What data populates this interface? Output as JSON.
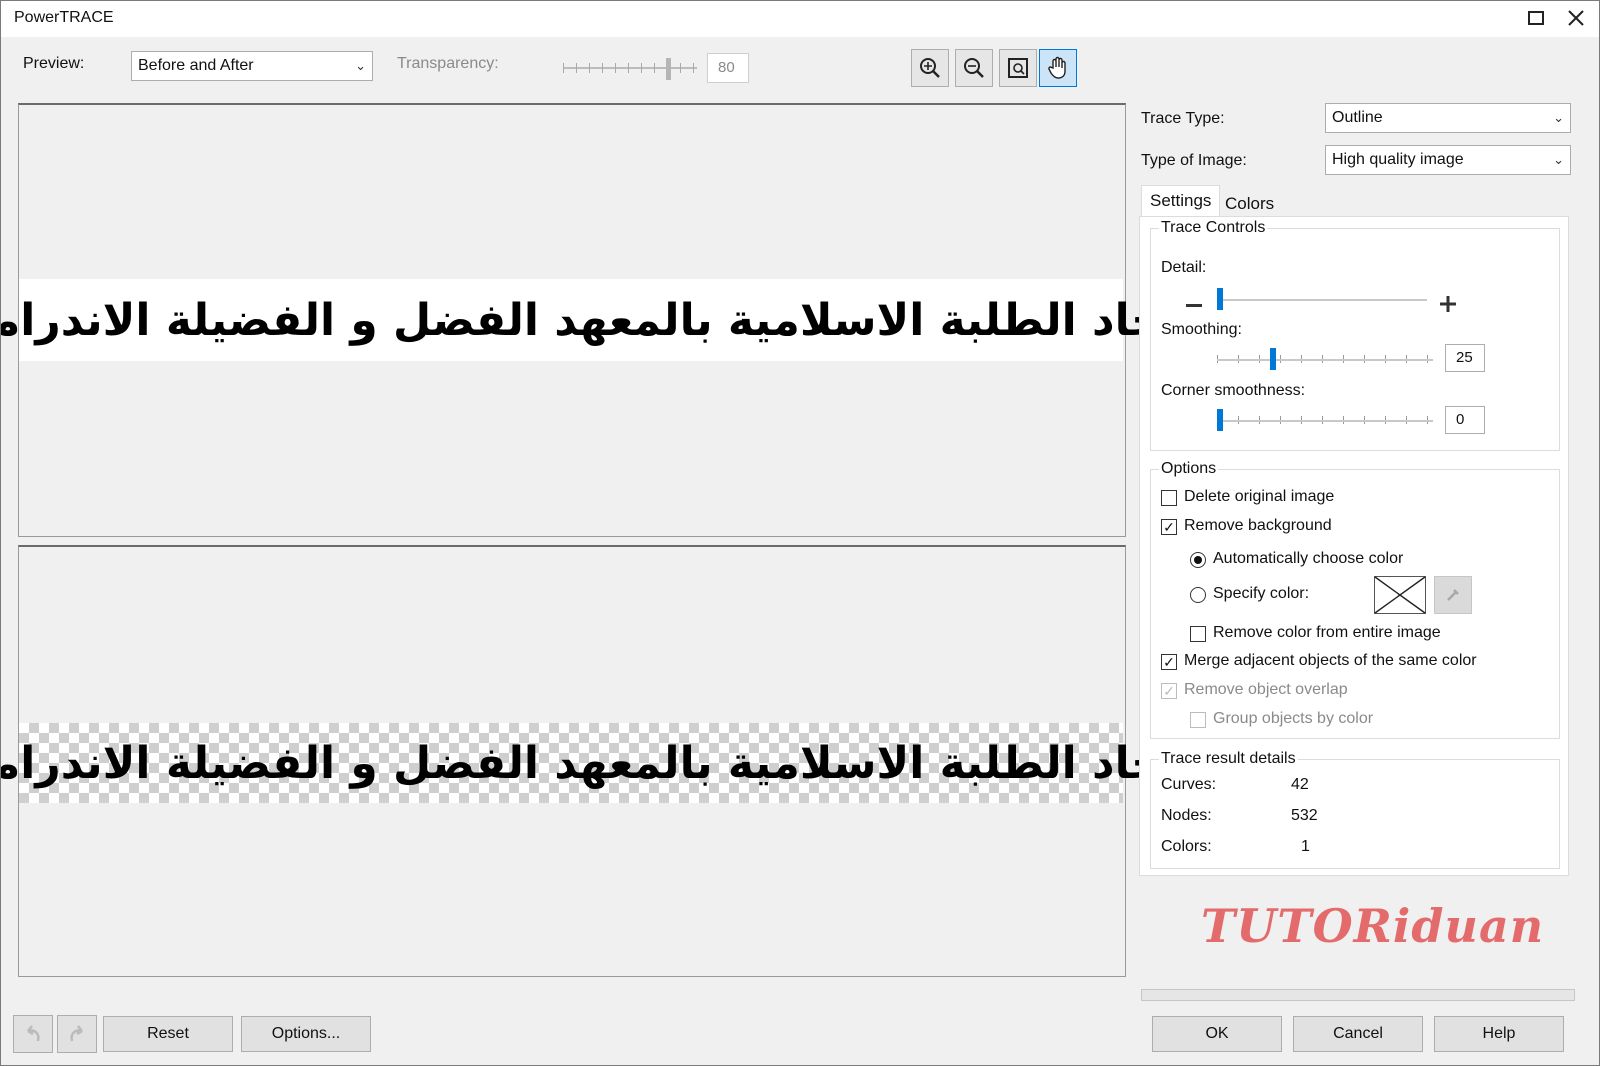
{
  "window": {
    "title": "PowerTRACE"
  },
  "toolbar": {
    "preview_label": "Preview:",
    "preview_value": "Before and After",
    "transparency_label": "Transparency:",
    "transparency_value": "80",
    "transparency_level": 0.8,
    "icons": [
      "zoom-in-icon",
      "zoom-out-icon",
      "fit-icon",
      "pan-hand-icon"
    ]
  },
  "preview": {
    "before_text": "اتحاد الطلبة الاسلامية بالمعهد الفضل و الفضيلة الاندراميو",
    "after_text": "اتحاد الطلبة الاسلامية بالمعهد الفضل و الفضيلة الاندراميو"
  },
  "panel": {
    "trace_type_label": "Trace Type:",
    "trace_type_value": "Outline",
    "image_type_label": "Type of Image:",
    "image_type_value": "High quality image",
    "tabs": [
      "Settings",
      "Colors"
    ],
    "trace_controls": {
      "legend": "Trace Controls",
      "detail_label": "Detail:",
      "detail_level": 0,
      "smoothing_label": "Smoothing:",
      "smoothing_value": "25",
      "corner_label": "Corner smoothness:",
      "corner_value": "0"
    },
    "options": {
      "legend": "Options",
      "delete_original": "Delete original image",
      "remove_background": "Remove background",
      "auto_color": "Automatically choose color",
      "specify_color": "Specify color:",
      "remove_color_entire": "Remove color from entire image",
      "merge_adjacent": "Merge adjacent objects of the same color",
      "remove_overlap": "Remove object overlap",
      "group_by_color": "Group objects by color"
    },
    "details": {
      "legend": "Trace result details",
      "curves_label": "Curves:",
      "curves_value": "42",
      "nodes_label": "Nodes:",
      "nodes_value": "532",
      "colors_label": "Colors:",
      "colors_value": "1"
    }
  },
  "watermark": "TUTORiduan",
  "buttons": {
    "reset": "Reset",
    "options": "Options...",
    "ok": "OK",
    "cancel": "Cancel",
    "help": "Help"
  },
  "colors": {
    "accent": "#0078d7",
    "watermark": "#e36b6b"
  }
}
